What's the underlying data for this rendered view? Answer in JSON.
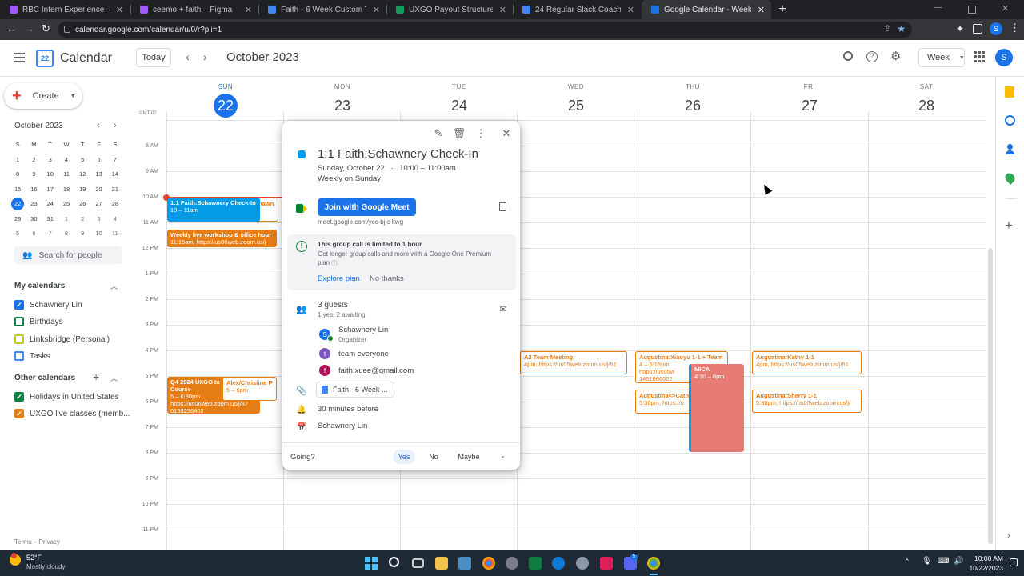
{
  "browser": {
    "tabs": [
      {
        "title": "RBC Intern Experience – Figma",
        "color": "#a259ff"
      },
      {
        "title": "ceemo + faith – Figma",
        "color": "#a259ff"
      },
      {
        "title": "Faith - 6 Week Custom Timeline",
        "color": "#4285f4"
      },
      {
        "title": "UXGO Payout Structure (UXD Co",
        "color": "#0f9d58"
      },
      {
        "title": "24 Regular Slack Coach Services",
        "color": "#4285f4"
      },
      {
        "title": "Google Calendar - Week of Octo",
        "color": "#1a73e8"
      }
    ],
    "url": "calendar.google.com/calendar/u/0/r?pli=1",
    "profile_initial": "S"
  },
  "app": {
    "name": "Calendar",
    "logo_number": "22",
    "today_label": "Today",
    "month_title": "October 2023",
    "view_label": "Week",
    "avatar": "S"
  },
  "sidebar": {
    "create_label": "Create",
    "minical": {
      "title": "October 2023",
      "weekdays": [
        "S",
        "M",
        "T",
        "W",
        "T",
        "F",
        "S"
      ],
      "weeks": [
        [
          "1",
          "2",
          "3",
          "4",
          "5",
          "6",
          "7"
        ],
        [
          "8",
          "9",
          "10",
          "11",
          "12",
          "13",
          "14"
        ],
        [
          "15",
          "16",
          "17",
          "18",
          "19",
          "20",
          "21"
        ],
        [
          "22",
          "23",
          "24",
          "25",
          "26",
          "27",
          "28"
        ],
        [
          "29",
          "30",
          "31",
          "1",
          "2",
          "3",
          "4"
        ],
        [
          "5",
          "6",
          "7",
          "8",
          "9",
          "10",
          "11"
        ]
      ]
    },
    "search_people": "Search for people",
    "my_calendars_title": "My calendars",
    "my_calendars": [
      {
        "label": "Schawnery Lin",
        "color": "#1a73e8",
        "checked": true
      },
      {
        "label": "Birthdays",
        "color": "#0b8043",
        "checked": false
      },
      {
        "label": "Linksbridge (Personal)",
        "color": "#c0ca33",
        "checked": false
      },
      {
        "label": "Tasks",
        "color": "#4285f4",
        "checked": false
      }
    ],
    "other_calendars_title": "Other calendars",
    "other_calendars": [
      {
        "label": "Holidays in United States",
        "color": "#0b8043",
        "checked": true
      },
      {
        "label": "UXGO live classes (memb...",
        "color": "#e67c14",
        "checked": true
      }
    ],
    "footer": "Terms – Privacy"
  },
  "week": {
    "timezone": "GMT-07",
    "days": [
      {
        "name": "SUN",
        "date": "22",
        "current": true
      },
      {
        "name": "MON",
        "date": "23"
      },
      {
        "name": "TUE",
        "date": "24"
      },
      {
        "name": "WED",
        "date": "25"
      },
      {
        "name": "THU",
        "date": "26"
      },
      {
        "name": "FRI",
        "date": "27"
      },
      {
        "name": "SAT",
        "date": "28"
      }
    ],
    "hours": [
      "8 AM",
      "9 AM",
      "10 AM",
      "11 AM",
      "12 PM",
      "1 PM",
      "2 PM",
      "3 PM",
      "4 PM",
      "5 PM",
      "6 PM",
      "7 PM",
      "8 PM",
      "9 PM",
      "10 PM",
      "11 PM"
    ],
    "events": {
      "checkin": {
        "title": "1:1 Faith:Schawnery Check-In",
        "time": "10 – 11am"
      },
      "shawn": {
        "title": "hawn"
      },
      "workshop": {
        "title": "Weekly live workshop & office hour 7",
        "sub": "11:15am, https://us06web.zoom.us/j"
      },
      "q4": {
        "title": "Q4 2024 UXGO In",
        "l2": "Course",
        "l3": "5 – 6:30pm",
        "l4": "https://us06web.zoom.us/j/87",
        "l5": "0153256402"
      },
      "alex": {
        "title": "Alex/Christine Po",
        "time": "5 – 6pm"
      },
      "a2": {
        "title": "A2 Team Meeting",
        "sub": "4pm, https://us05web.zoom.us/j/51"
      },
      "xiaoyu": {
        "title": "Augustina:Xiaoyu 1-1 + Team",
        "time": "4 – 5:15pm",
        "sub": "https://us05w",
        "sub2": "1401866022"
      },
      "cath": {
        "title": "Augustina<>Cath",
        "sub": "5:30pm, https://u"
      },
      "mica": {
        "title": "MICA",
        "time": "4:30 – 8pm"
      },
      "kathy": {
        "title": "Augustina:Kathy 1-1",
        "sub": "4pm, https://us05web.zoom.us/j/51"
      },
      "sherry": {
        "title": "Augustina:Sherry 1-1",
        "sub": "5:30pm, https://us05web.zoom.us/j/"
      }
    }
  },
  "popup": {
    "title": "1:1 Faith:Schawnery Check-In",
    "date": "Sunday, October 22",
    "time": "10:00 – 11:00am",
    "recurrence": "Weekly on Sunday",
    "meet_button": "Join with Google Meet",
    "meet_link": "meet.google.com/ycc-bjic-kwg",
    "notice_title": "This group call is limited to 1 hour",
    "notice_body": "Get longer group calls and more with a Google One Premium",
    "notice_body2": "plan",
    "explore_label": "Explore plan",
    "no_thanks_label": "No thanks",
    "guests_title": "3 guests",
    "guests_sub": "1 yes, 2 awaiting",
    "guests": [
      {
        "initial": "S",
        "name": "Schawnery Lin",
        "role": "Organizer",
        "color": "#1a73e8"
      },
      {
        "initial": "t",
        "name": "team everyone",
        "role": "",
        "color": "#7e57c2"
      },
      {
        "initial": "f",
        "name": "faith.xuee@gmail.com",
        "role": "",
        "color": "#ad1457"
      }
    ],
    "attachment": "Faith - 6 Week ...",
    "reminder": "30 minutes before",
    "organizer": "Schawnery Lin",
    "going_label": "Going?",
    "yes": "Yes",
    "no": "No",
    "maybe": "Maybe"
  },
  "taskbar": {
    "weather_temp": "52°F",
    "weather_desc": "Mostly cloudy",
    "time": "10:00 AM",
    "date": "10/22/2023"
  }
}
